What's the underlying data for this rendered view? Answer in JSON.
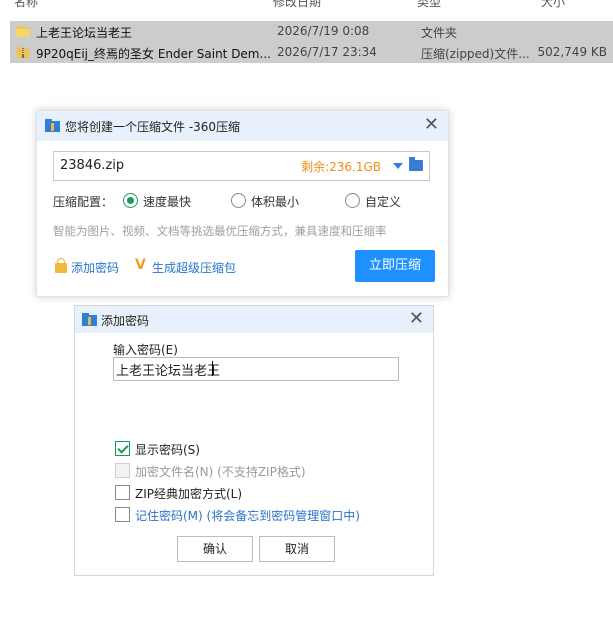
{
  "explorer": {
    "columns": {
      "name": "名称",
      "date": "修改日期",
      "type": "类型",
      "size": "大小"
    },
    "rows": [
      {
        "name": "上老王论坛当老王",
        "date": "2026/7/19 0:08",
        "type": "文件夹",
        "size": "",
        "icon": "folder-icon"
      },
      {
        "name": "9P20qEij_终焉的圣女 Ender Saint Dem...",
        "date": "2026/7/17 23:34",
        "type": "压缩(zipped)文件...",
        "size": "502,749 KB",
        "icon": "zip-icon"
      }
    ]
  },
  "compress_dialog": {
    "title": "您将创建一个压缩文件 -360压缩",
    "path_value": "23846.zip",
    "remaining": "剩余:236.1GB",
    "config_label": "压缩配置：",
    "options": [
      {
        "label": "速度最快",
        "selected": true
      },
      {
        "label": "体积最小",
        "selected": false
      },
      {
        "label": "自定义",
        "selected": false
      }
    ],
    "hint": "智能为图片、视频、文档等挑选最优压缩方式，兼具速度和压缩率",
    "add_password_link": "添加密码",
    "super_package_link": "生成超级压缩包",
    "compress_button": "立即压缩",
    "accent_color": "#1e90ff"
  },
  "password_dialog": {
    "title": "添加密码",
    "input_label": "输入密码(E)",
    "password_value": "上老王论坛当老王",
    "checkboxes": [
      {
        "label": "显示密码(S)",
        "checked": true,
        "disabled": false
      },
      {
        "label": "加密文件名(N) (不支持ZIP格式)",
        "checked": false,
        "disabled": true
      },
      {
        "label": "ZIP经典加密方式(L)",
        "checked": false,
        "disabled": false
      },
      {
        "label": "记住密码(M) (将会备忘到密码管理窗口中)",
        "checked": false,
        "disabled": false
      }
    ],
    "ok_button": "确认",
    "cancel_button": "取消"
  }
}
